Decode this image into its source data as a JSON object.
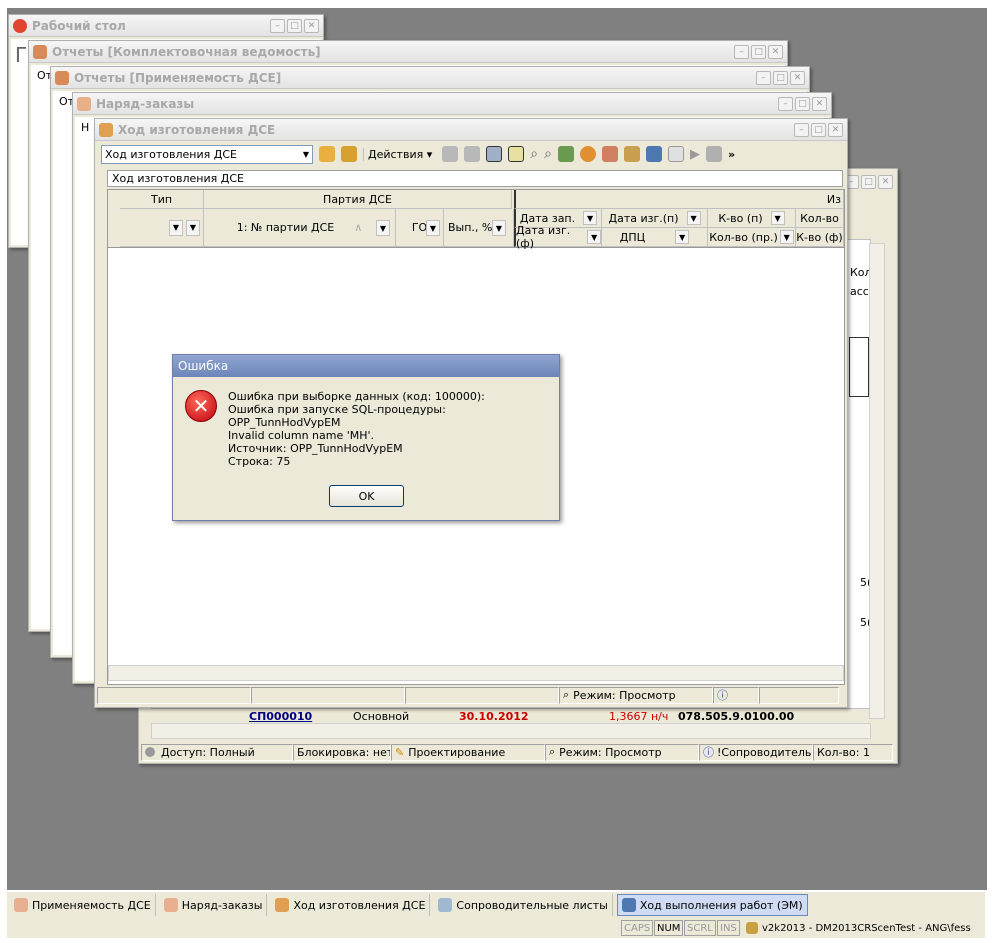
{
  "windows": {
    "desktop": {
      "title": "Рабочий стол"
    },
    "kompl": {
      "title": "Отчеты  [Комплектовочная ведомость]"
    },
    "prim": {
      "title": "Отчеты  [Применяемость ДСЕ]"
    },
    "naryad": {
      "title": "Наряд-заказы"
    },
    "hod": {
      "title": "Ход изготовления ДСЕ"
    }
  },
  "hod_window": {
    "combo_value": "Ход изготовления ДСЕ",
    "actions_label": "Действия",
    "panel_caption": "Ход изготовления ДСЕ",
    "header_group_tip": "Тип",
    "header_group_partia": "Партия ДСЕ",
    "header_group_iz": "Из",
    "col_nomer": "1: № партии ДСЕ",
    "col_go": "ГО",
    "col_vyp": "Вып., %",
    "col_data_zap": "Дата зап.",
    "col_data_izg_p": "Дата изг.(п)",
    "col_kvo_p": "К-во (п)",
    "col_kolvo": "Кол-во",
    "col_data_izg_f": "Дата изг.(ф)",
    "col_dpc": "ДПЦ",
    "col_kolvo_pr": "Кол-во (пр.)",
    "col_kvo_f": "К-во (ф)",
    "status_mode": "Режим: Просмотр"
  },
  "back_window": {
    "partial_header_1": "Кол",
    "partial_header_2": "асса",
    "side_values": [
      "5(",
      "5("
    ],
    "row": {
      "number": "СП000010",
      "type": "Основной",
      "date": "30.10.2012",
      "rate": "1,3667 н/ч",
      "code": "078.505.9.0100.00"
    },
    "status": {
      "access": "Доступ: Полный",
      "lock": "Блокировка: нет",
      "design": "Проектирование",
      "mode": "Режим: Просмотр",
      "doc": "!Сопроводительн",
      "count": "Кол-во: 1"
    }
  },
  "dialog": {
    "title": "Ошибка",
    "lines": [
      "Ошибка при выборке данных (код: 100000):",
      "Ошибка при запуске SQL-процедуры: OPP_TunnHodVypEM",
      "Invalid column name 'MH'.",
      "Источник: OPP_TunnHodVypEM",
      "Строка: 75"
    ],
    "ok_label": "OK"
  },
  "taskbar": {
    "items": [
      {
        "label": "Применяемость ДСЕ",
        "active": false
      },
      {
        "label": "Наряд-заказы",
        "active": false
      },
      {
        "label": "Ход изготовления ДСЕ",
        "active": false
      },
      {
        "label": "Сопроводительные листы",
        "active": false
      },
      {
        "label": "Ход выполнения работ (ЭМ)",
        "active": true
      }
    ]
  },
  "bottom_status": {
    "caps": "CAPS",
    "num": "NUM",
    "scrl": "SCRL",
    "ins": "INS",
    "session": "v2k2013 - DM2013CRScenTest - ANG\\fess"
  },
  "partial_labels": {
    "p1": "Г",
    "p2": "От",
    "p3": "От",
    "p4": "Н",
    "p5": "Н"
  },
  "colors": {
    "title_inactive": "#a8a8a8",
    "dialog_title": "#6d86b8",
    "error_red": "#c0000d",
    "date_red": "#cc0000",
    "number_blue": "#000080"
  }
}
